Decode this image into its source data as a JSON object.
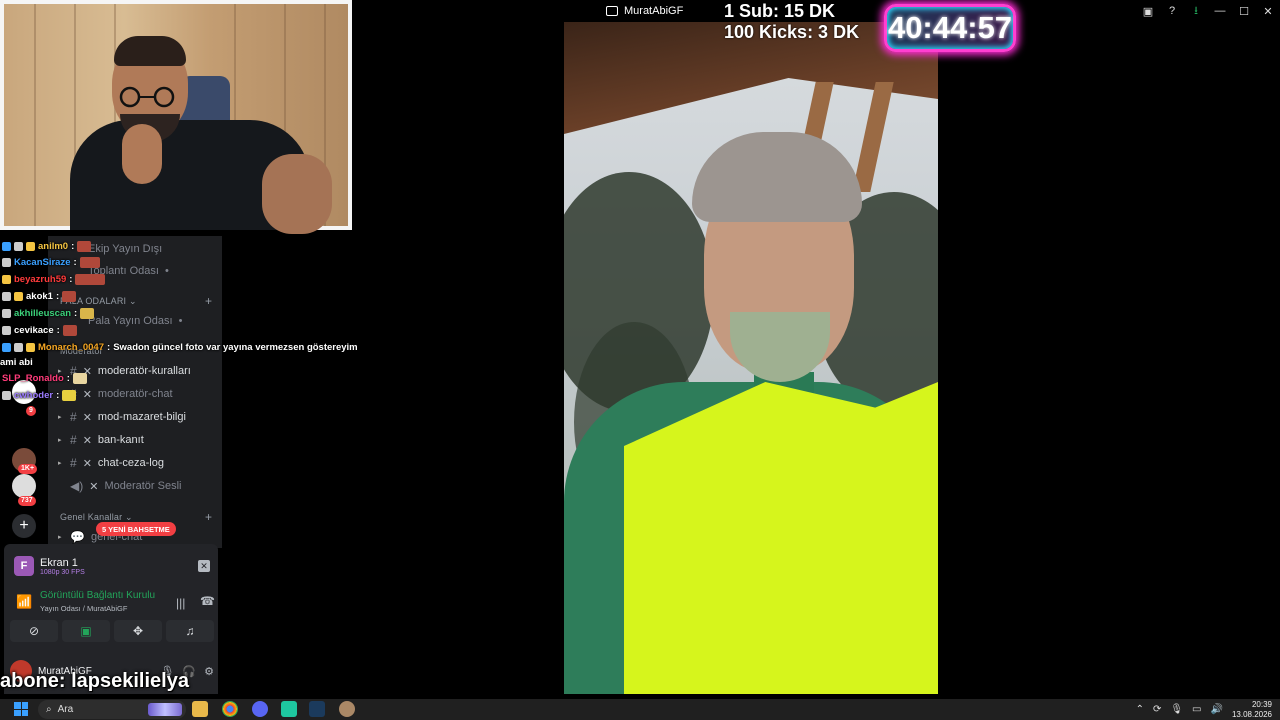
{
  "window": {
    "title": "MuratAbiGF",
    "controls": [
      "panel-icon",
      "help-icon",
      "download-icon",
      "minimize-icon",
      "maximize-icon",
      "close-icon"
    ]
  },
  "overlay": {
    "counter_sub": "1 Sub: 15 DK",
    "counter_kicks": "100 Kicks: 3 DK",
    "timer": "40:44:57",
    "subscribe": "abone: lapsekilielya"
  },
  "chat": [
    {
      "user": "anilm0",
      "color": "#f5c542",
      "text": ""
    },
    {
      "user": "KacanSiraze",
      "color": "#3aa0ff",
      "text": ""
    },
    {
      "user": "beyazruh59",
      "color": "#ff3b3b",
      "text": ""
    },
    {
      "user": "akok1",
      "color": "#ffffff",
      "text": ""
    },
    {
      "user": "akhilleuscan",
      "color": "#3bd17a",
      "text": ""
    },
    {
      "user": "cevikace",
      "color": "#ffffff",
      "text": ""
    },
    {
      "user": "Monarch_0047",
      "color": "#f5a623",
      "text": "Swadon güncel foto var yayına vermezsen göstereyim"
    },
    {
      "user": "SLP_Ronaldo",
      "color": "#ff3b7a",
      "text": ""
    },
    {
      "user": "cwhoder",
      "color": "#9b7bff",
      "text": ""
    }
  ],
  "chat_prefix": "ami abi",
  "discord": {
    "channels_top": [
      {
        "name": "Ekip Yayın Dışı",
        "muted": true
      },
      {
        "name": "Toplantı Odası",
        "muted": true
      }
    ],
    "category_pala": "PALA ODALARI",
    "channel_pala": "Pala Yayın Odası",
    "category_mod": "Moderatör",
    "mod_channels": [
      {
        "name": "moderatör-kuralları",
        "muted": false,
        "type": "text"
      },
      {
        "name": "moderatör-chat",
        "muted": true,
        "type": "text"
      },
      {
        "name": "mod-mazaret-bilgi",
        "muted": false,
        "type": "text"
      },
      {
        "name": "ban-kanıt",
        "muted": false,
        "type": "text"
      },
      {
        "name": "chat-ceza-log",
        "muted": false,
        "type": "text"
      },
      {
        "name": "Moderatör Sesli",
        "muted": true,
        "type": "voice"
      }
    ],
    "category_general": "Genel Kanallar",
    "general_channel": "genel-chat",
    "mentions_pill": "5 YENİ BAHSETME",
    "guild_badges": [
      "9",
      "20",
      "1K+",
      "737"
    ]
  },
  "voice_panel": {
    "screen_title": "Ekran 1",
    "screen_quality": "1080p 30 FPS",
    "status": "Görüntülü Bağlantı Kurulu",
    "channel": "Yayın Odası",
    "server": "MuratAbiGF",
    "user": "MuratAbiGF"
  },
  "taskbar": {
    "search_placeholder": "Ara",
    "time": "20:39",
    "date": "13.08.2026"
  },
  "colors": {
    "timer_glow": "#ff3fd0",
    "discord_green": "#23a55a",
    "discord_red": "#f23f43",
    "vest": "#d6f51c"
  }
}
